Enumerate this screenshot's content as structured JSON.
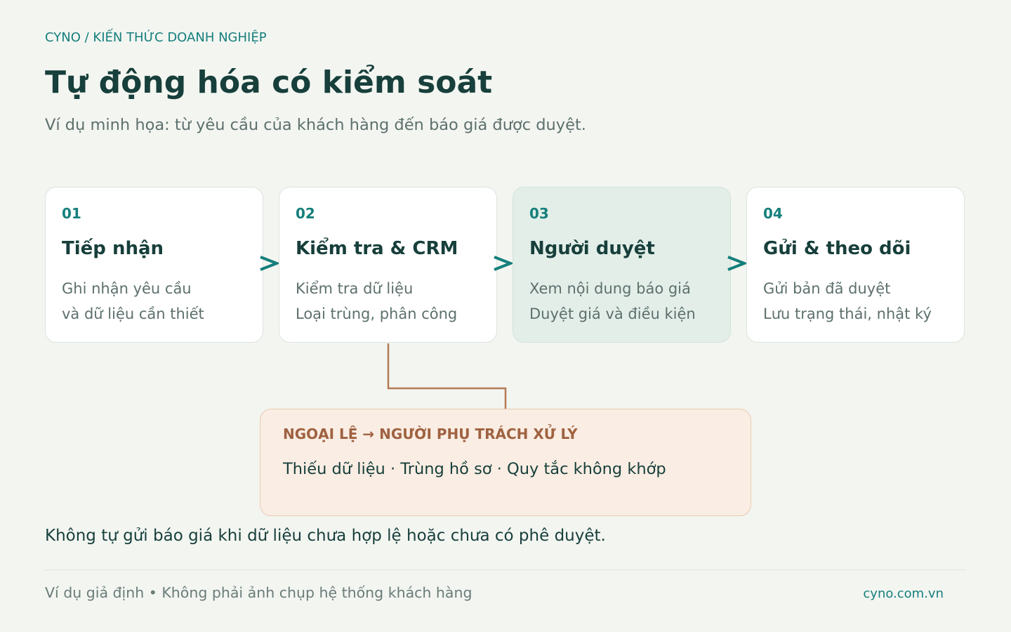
{
  "header": {
    "breadcrumb": "CYNO / KIẾN THỨC DOANH NGHIỆP",
    "title": "Tự động hóa có kiểm soát",
    "subtitle": "Ví dụ minh họa: từ yêu cầu của khách hàng đến báo giá được duyệt."
  },
  "steps": [
    {
      "number": "01",
      "title": "Tiếp nhận",
      "lines": [
        "Ghi nhận yêu cầu",
        "và dữ liệu cần thiết"
      ],
      "highlighted": false
    },
    {
      "number": "02",
      "title": "Kiểm tra & CRM",
      "lines": [
        "Kiểm tra dữ liệu",
        "Loại trùng, phân công"
      ],
      "highlighted": false
    },
    {
      "number": "03",
      "title": "Người duyệt",
      "lines": [
        "Xem nội dung báo giá",
        "Duyệt giá và điều kiện"
      ],
      "highlighted": true
    },
    {
      "number": "04",
      "title": "Gửi & theo dõi",
      "lines": [
        "Gửi bản đã duyệt",
        "Lưu trạng thái, nhật ký"
      ],
      "highlighted": false
    }
  ],
  "exception": {
    "title": "NGOẠI LỆ → NGƯỜI PHỤ TRÁCH XỬ LÝ",
    "items": "Thiếu dữ liệu · Trùng hồ sơ · Quy tắc không khớp"
  },
  "note": "Không tự gửi báo giá khi dữ liệu chưa hợp lệ hoặc chưa có phê duyệt.",
  "footer": {
    "disclaimer": "Ví dụ giả định • Không phải ảnh chụp hệ thống khách hàng",
    "website": "cyno.com.vn"
  },
  "colors": {
    "background": "#f3f5f1",
    "accent": "#157f7c",
    "heading": "#173f3b",
    "muted": "#5d706d",
    "highlight_card": "#e3eee9",
    "exception_fill": "#faede3",
    "exception_text": "#9f6241",
    "connector": "#b57a55"
  },
  "icons": {
    "flow_arrow": "chevron-right-icon"
  }
}
